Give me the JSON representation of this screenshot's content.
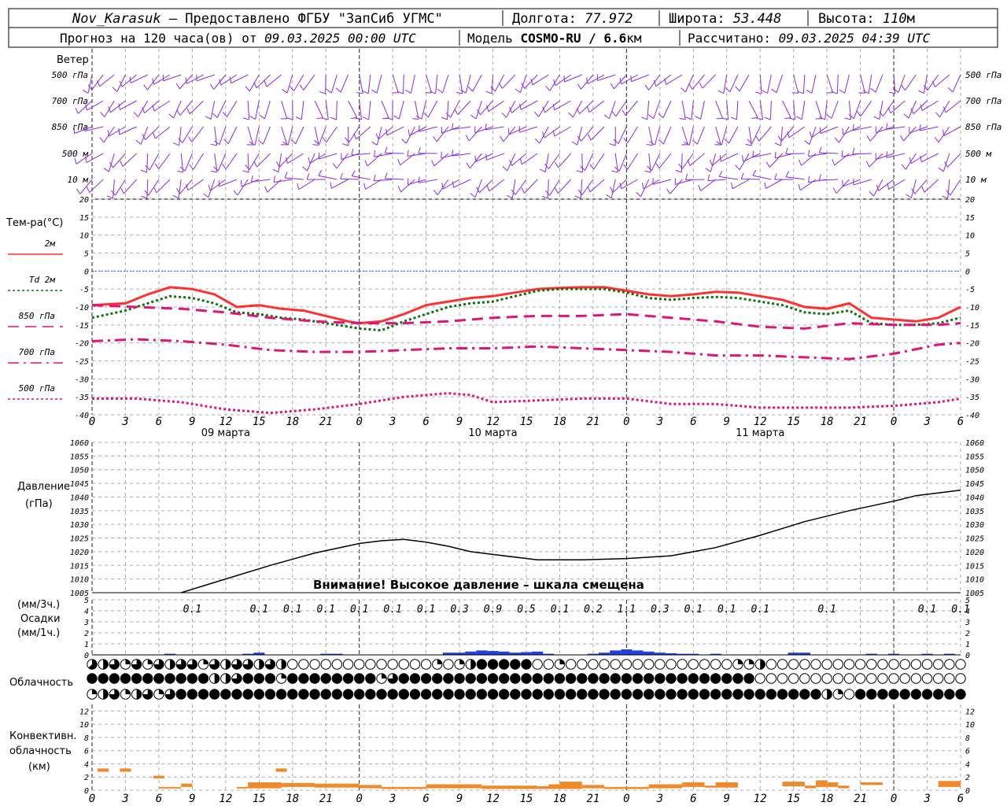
{
  "header": {
    "station": "Nov_Karasuk",
    "provider": " – Предоставлено ФГБУ \"ЗапСиб УГМС\"",
    "lon_label": "Долгота: ",
    "lon": "77.972",
    "lat_label": "Широта: ",
    "lat": "53.448",
    "alt_label": "Высота: ",
    "alt": "110",
    "alt_unit": "м",
    "forecast_label": "Прогноз на 120 часа(ов) от ",
    "forecast_from": "09.03.2025 00:00 UTC",
    "model_label": "Модель ",
    "model": "COSMO-RU / 6.6",
    "model_unit": "км",
    "computed_label": "Рассчитано: ",
    "computed": "09.03.2025 04:39 UTC"
  },
  "wind_panel": {
    "title": "Ветер",
    "levels": [
      "500 гПа",
      "700 гПа",
      "850 гПа",
      "500 м",
      "10 м"
    ],
    "color": "#8a2be2"
  },
  "temp_panel": {
    "title": "Тем-ра(°С)",
    "legend": [
      {
        "label": "2м",
        "color": "#ff3030",
        "dash": "solid"
      },
      {
        "label": "Td  2м",
        "color": "#107010",
        "dash": "dot"
      },
      {
        "label": "850 гПа",
        "color": "#e0157a",
        "dash": "dash"
      },
      {
        "label": "700 гПа",
        "color": "#e0157a",
        "dash": "dashdot"
      },
      {
        "label": "500 гПа",
        "color": "#e0157a",
        "dash": "dot"
      }
    ],
    "yticks": [
      20,
      15,
      10,
      5,
      0,
      -5,
      -10,
      -15,
      -20,
      -25,
      -30,
      -35,
      -40
    ]
  },
  "time_axis": {
    "hours": [
      "0",
      "3",
      "6",
      "9",
      "12",
      "15",
      "18",
      "21",
      "0",
      "3",
      "6",
      "9",
      "12",
      "15",
      "18",
      "21",
      "0",
      "3",
      "6",
      "9",
      "12",
      "15",
      "18",
      "21",
      "0",
      "3",
      "6"
    ],
    "days": [
      "09 марта",
      "10 марта",
      "11 марта"
    ]
  },
  "pressure_panel": {
    "title": "Давление",
    "unit": "(гПа)",
    "yticks": [
      1060,
      1055,
      1050,
      1045,
      1040,
      1035,
      1030,
      1025,
      1020,
      1015,
      1010,
      1005
    ],
    "warning": "Внимание! Высокое давление – шкала смещена"
  },
  "precip_panel": {
    "unit3": "(мм/3ч.)",
    "title": "Осадки",
    "unit1": "(мм/1ч.)",
    "yticks": [
      5,
      4,
      3,
      2,
      1,
      0
    ],
    "labels": [
      {
        "h": 9,
        "v": "0.1"
      },
      {
        "h": 15,
        "v": "0.1"
      },
      {
        "h": 18,
        "v": "0.1"
      },
      {
        "h": 21,
        "v": "0.1"
      },
      {
        "h": 24,
        "v": "0.1"
      },
      {
        "h": 27,
        "v": "0.1"
      },
      {
        "h": 30,
        "v": "0.1"
      },
      {
        "h": 33,
        "v": "0.3"
      },
      {
        "h": 36,
        "v": "0.9"
      },
      {
        "h": 39,
        "v": "0.5"
      },
      {
        "h": 42,
        "v": "0.1"
      },
      {
        "h": 45,
        "v": "0.2"
      },
      {
        "h": 48,
        "v": "1.1"
      },
      {
        "h": 51,
        "v": "0.3"
      },
      {
        "h": 54,
        "v": "0.1"
      },
      {
        "h": 57,
        "v": "0.1"
      },
      {
        "h": 60,
        "v": "0.1"
      },
      {
        "h": 66,
        "v": "0.1"
      },
      {
        "h": 75,
        "v": "0.1"
      },
      {
        "h": 78,
        "v": "0.1"
      }
    ],
    "color": "#1f3fe0"
  },
  "cloud_panel": {
    "title": "Облачность"
  },
  "conv_panel": {
    "title1": "Конвективн.",
    "title2": "облачность",
    "unit": "(км)",
    "yticks": [
      12,
      10,
      8,
      6,
      4,
      2,
      0
    ],
    "color": "#f0892a"
  },
  "chart_data": [
    {
      "type": "line",
      "title": "Тем-ра(°С)",
      "x_unit": "hours from 09.03.2025 00:00 UTC",
      "ylim": [
        -40,
        20
      ],
      "series": [
        {
          "name": "2м",
          "x": [
            0,
            3,
            5,
            7,
            9,
            11,
            13,
            15,
            17,
            19,
            21,
            23,
            24,
            26,
            28,
            30,
            32,
            34,
            36,
            38,
            40,
            42,
            44,
            46,
            48,
            50,
            52,
            54,
            56,
            58,
            60,
            62,
            64,
            66,
            68,
            70,
            72,
            74,
            76,
            78
          ],
          "y": [
            -9.5,
            -9,
            -6.5,
            -4.5,
            -5,
            -6.5,
            -10,
            -9.5,
            -10.5,
            -11,
            -12.5,
            -14,
            -14.5,
            -14,
            -12,
            -9.5,
            -8.5,
            -7.5,
            -7,
            -6,
            -5,
            -4.7,
            -4.5,
            -4.5,
            -5.5,
            -6.5,
            -7,
            -6.5,
            -5.8,
            -6,
            -7,
            -8,
            -10,
            -10.5,
            -9,
            -13,
            -13.5,
            -14,
            -13,
            -10
          ]
        },
        {
          "name": "Td  2м",
          "x": [
            0,
            3,
            5,
            7,
            9,
            11,
            13,
            15,
            17,
            19,
            21,
            23,
            24,
            26,
            28,
            30,
            32,
            34,
            36,
            38,
            40,
            42,
            44,
            46,
            48,
            50,
            52,
            54,
            56,
            58,
            60,
            62,
            64,
            66,
            68,
            70,
            72,
            74,
            76,
            78
          ],
          "y": [
            -13,
            -11,
            -9,
            -7,
            -7.5,
            -9,
            -11.5,
            -12,
            -13,
            -13.5,
            -14.5,
            -15.5,
            -16,
            -16.5,
            -14,
            -12,
            -10,
            -9,
            -8.5,
            -7,
            -5.5,
            -5,
            -5,
            -5,
            -6,
            -7.5,
            -8,
            -7.5,
            -7.2,
            -7.5,
            -8.5,
            -9.5,
            -11.5,
            -12,
            -11,
            -14.5,
            -15,
            -15,
            -14.5,
            -13
          ]
        },
        {
          "name": "850 гПа",
          "x": [
            0,
            4,
            8,
            12,
            16,
            20,
            24,
            28,
            32,
            36,
            40,
            44,
            48,
            52,
            56,
            60,
            64,
            68,
            72,
            76,
            78
          ],
          "y": [
            -9.5,
            -10,
            -10.5,
            -11.5,
            -13,
            -14,
            -14.5,
            -14.5,
            -14,
            -13,
            -12.5,
            -12.5,
            -12,
            -13,
            -14,
            -15.5,
            -16,
            -14.5,
            -15,
            -15,
            -14.5
          ]
        },
        {
          "name": "700 гПа",
          "x": [
            0,
            4,
            8,
            12,
            16,
            20,
            24,
            28,
            32,
            36,
            40,
            44,
            48,
            52,
            56,
            60,
            64,
            68,
            72,
            76,
            78
          ],
          "y": [
            -19.5,
            -19,
            -19.5,
            -20.5,
            -22,
            -22.5,
            -22.5,
            -22,
            -21.5,
            -21.5,
            -21,
            -21.5,
            -22,
            -22.5,
            -23.5,
            -23.5,
            -24,
            -24.5,
            -23,
            -20.5,
            -20
          ]
        },
        {
          "name": "500 гПа",
          "x": [
            0,
            4,
            8,
            12,
            16,
            20,
            24,
            28,
            32,
            34,
            36,
            40,
            44,
            48,
            52,
            56,
            60,
            64,
            68,
            72,
            76,
            78
          ],
          "y": [
            -35.5,
            -35.5,
            -36.5,
            -38.5,
            -39.5,
            -38.5,
            -37,
            -35,
            -34,
            -34.5,
            -36.5,
            -36,
            -35.5,
            -35.5,
            -37,
            -37,
            -38,
            -38,
            -38,
            -37.5,
            -36.5,
            -35.5
          ]
        }
      ]
    },
    {
      "type": "line",
      "title": "Давление",
      "ylim": [
        1005,
        1060
      ],
      "series": [
        {
          "name": "Давление",
          "x": [
            8,
            12,
            16,
            20,
            24,
            26,
            28,
            30,
            32,
            34,
            36,
            40,
            44,
            48,
            52,
            56,
            60,
            64,
            68,
            72,
            74,
            76,
            78
          ],
          "y": [
            1005,
            1010,
            1015,
            1019.5,
            1023,
            1024,
            1024.5,
            1023.5,
            1022,
            1020,
            1019,
            1017,
            1017,
            1017.5,
            1018.5,
            1021.5,
            1026,
            1031,
            1035,
            1038.5,
            1040.5,
            1041.5,
            1042.5
          ]
        }
      ]
    },
    {
      "type": "bar",
      "title": "Осадки",
      "ylim": [
        0,
        5
      ],
      "series": [
        {
          "name": "мм/1ч.",
          "x": [
            7,
            14,
            15,
            21,
            22,
            32,
            33,
            34,
            35,
            36,
            37,
            38,
            39,
            40,
            41,
            45,
            46,
            47,
            48,
            49,
            50,
            51,
            52,
            53,
            54,
            56,
            63,
            64,
            70,
            72,
            75,
            77
          ],
          "y": [
            0.1,
            0.1,
            0.2,
            0.1,
            0.1,
            0.2,
            0.2,
            0.3,
            0.4,
            0.35,
            0.3,
            0.2,
            0.25,
            0.3,
            0.1,
            0.1,
            0.2,
            0.4,
            0.5,
            0.4,
            0.3,
            0.2,
            0.15,
            0.1,
            0.1,
            0.1,
            0.2,
            0.2,
            0.1,
            0.1,
            0.1,
            0.1
          ]
        }
      ]
    },
    {
      "type": "table",
      "title": "Облачность",
      "note": "cloud cover in octants per hour, 3 rows",
      "rows": [
        [
          5,
          4,
          6,
          2,
          6,
          2,
          6,
          4,
          6,
          6,
          2,
          6,
          4,
          6,
          6,
          4,
          6,
          4,
          0,
          0,
          0,
          0,
          0,
          0,
          0,
          0,
          0,
          0,
          0,
          0,
          0,
          2,
          0,
          2,
          4,
          8,
          8,
          8,
          8,
          8,
          0,
          0,
          2,
          0,
          0,
          0,
          0,
          0,
          0,
          0,
          0,
          0,
          0,
          0,
          0,
          0,
          0,
          0,
          2,
          2,
          4,
          0,
          0,
          0,
          0,
          0,
          0,
          0,
          0,
          0,
          0,
          0,
          0,
          0,
          0,
          0,
          0,
          0,
          0
        ],
        [
          8,
          8,
          8,
          8,
          8,
          8,
          8,
          8,
          8,
          8,
          8,
          4,
          4,
          6,
          8,
          8,
          8,
          2,
          8,
          8,
          8,
          8,
          8,
          8,
          8,
          8,
          2,
          6,
          8,
          8,
          8,
          8,
          8,
          8,
          8,
          8,
          8,
          8,
          8,
          8,
          8,
          8,
          8,
          8,
          8,
          8,
          8,
          8,
          8,
          8,
          8,
          8,
          8,
          8,
          8,
          8,
          8,
          8,
          8,
          8,
          0,
          0,
          0,
          0,
          0,
          0,
          0,
          0,
          0,
          0,
          0,
          0,
          0,
          0,
          0,
          0,
          0,
          0,
          0
        ],
        [
          2,
          4,
          6,
          2,
          4,
          6,
          2,
          6,
          8,
          8,
          8,
          8,
          8,
          8,
          8,
          8,
          8,
          8,
          8,
          8,
          8,
          8,
          8,
          8,
          8,
          8,
          8,
          8,
          8,
          8,
          8,
          8,
          8,
          8,
          8,
          8,
          8,
          8,
          8,
          8,
          8,
          8,
          8,
          8,
          8,
          8,
          8,
          8,
          8,
          8,
          8,
          8,
          8,
          8,
          8,
          8,
          8,
          8,
          8,
          8,
          8,
          8,
          8,
          8,
          8,
          8,
          4,
          2,
          0,
          8,
          8,
          8,
          8,
          8,
          8,
          8,
          8,
          8,
          8
        ]
      ]
    },
    {
      "type": "bar",
      "title": "Конвективн. облачность",
      "ylim": [
        0,
        13
      ],
      "bars": [
        {
          "x0": 0.5,
          "x1": 1.5,
          "lo": 2.8,
          "hi": 3.3
        },
        {
          "x0": 2.5,
          "x1": 3.5,
          "lo": 2.8,
          "hi": 3.3
        },
        {
          "x0": 5.5,
          "x1": 6.5,
          "lo": 1.8,
          "hi": 2.2
        },
        {
          "x0": 6,
          "x1": 8,
          "lo": 0.3,
          "hi": 0.5
        },
        {
          "x0": 8,
          "x1": 9,
          "lo": 0.5,
          "hi": 1.0
        },
        {
          "x0": 13,
          "x1": 14,
          "lo": 0.3,
          "hi": 0.5
        },
        {
          "x0": 14,
          "x1": 17,
          "lo": 0.3,
          "hi": 1.2
        },
        {
          "x0": 16.5,
          "x1": 17.5,
          "lo": 2.8,
          "hi": 3.3
        },
        {
          "x0": 17,
          "x1": 20,
          "lo": 0.5,
          "hi": 1.1
        },
        {
          "x0": 20,
          "x1": 24,
          "lo": 0.4,
          "hi": 1.0
        },
        {
          "x0": 24,
          "x1": 26,
          "lo": 0.3,
          "hi": 0.8
        },
        {
          "x0": 26,
          "x1": 30,
          "lo": 0.2,
          "hi": 0.5
        },
        {
          "x0": 30,
          "x1": 35,
          "lo": 0.3,
          "hi": 0.9
        },
        {
          "x0": 35,
          "x1": 40,
          "lo": 0.2,
          "hi": 0.7
        },
        {
          "x0": 40,
          "x1": 44,
          "lo": 0.2,
          "hi": 0.6
        },
        {
          "x0": 41,
          "x1": 42,
          "lo": 0.3,
          "hi": 0.9
        },
        {
          "x0": 42,
          "x1": 44,
          "lo": 0.3,
          "hi": 1.3
        },
        {
          "x0": 44,
          "x1": 46,
          "lo": 0.3,
          "hi": 0.8
        },
        {
          "x0": 46,
          "x1": 50,
          "lo": 0.2,
          "hi": 0.5
        },
        {
          "x0": 50,
          "x1": 53,
          "lo": 0.3,
          "hi": 0.9
        },
        {
          "x0": 53,
          "x1": 55,
          "lo": 0.5,
          "hi": 1.2
        },
        {
          "x0": 55,
          "x1": 56,
          "lo": 0.4,
          "hi": 0.7
        },
        {
          "x0": 56,
          "x1": 58,
          "lo": 0.4,
          "hi": 1.2
        },
        {
          "x0": 62,
          "x1": 64,
          "lo": 0.6,
          "hi": 1.3
        },
        {
          "x0": 64,
          "x1": 65,
          "lo": 0.3,
          "hi": 0.7
        },
        {
          "x0": 65,
          "x1": 66,
          "lo": 0.5,
          "hi": 1.5
        },
        {
          "x0": 66,
          "x1": 67,
          "lo": 0.5,
          "hi": 1.2
        },
        {
          "x0": 67,
          "x1": 68,
          "lo": 0.3,
          "hi": 0.7
        },
        {
          "x0": 69,
          "x1": 71,
          "lo": 0.8,
          "hi": 1.2
        },
        {
          "x0": 76,
          "x1": 78,
          "lo": 0.5,
          "hi": 1.4
        }
      ]
    }
  ]
}
